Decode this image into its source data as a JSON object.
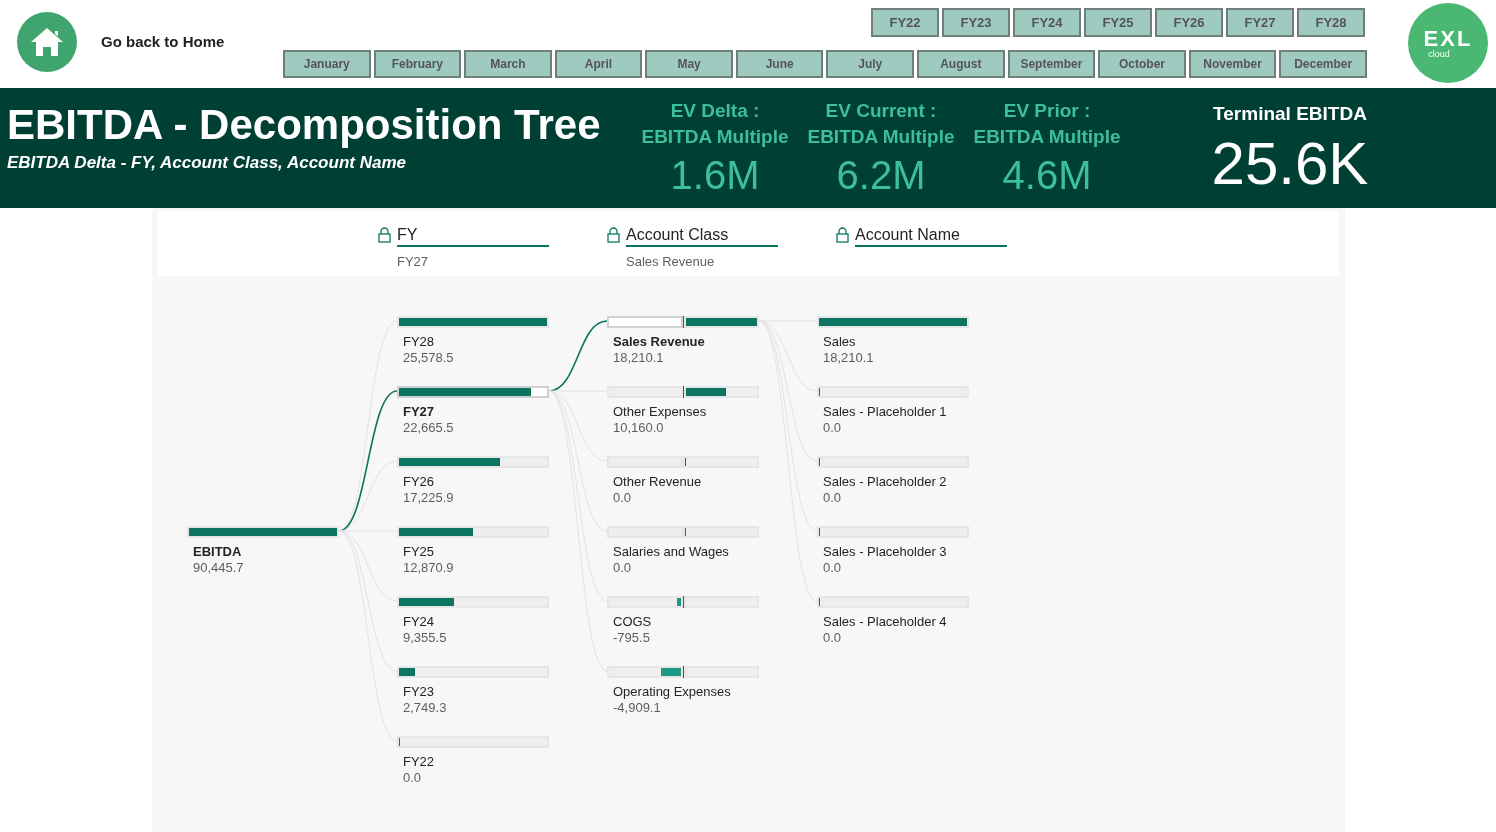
{
  "home_link": {
    "label": "Go back to Home"
  },
  "fy_buttons": [
    "FY22",
    "FY23",
    "FY24",
    "FY25",
    "FY26",
    "FY27",
    "FY28"
  ],
  "month_buttons": [
    "January",
    "February",
    "March",
    "April",
    "May",
    "June",
    "July",
    "August",
    "September",
    "October",
    "November",
    "December"
  ],
  "logo": {
    "text": "EXL",
    "subtext": "cloud"
  },
  "banner": {
    "title": "EBITDA - Decomposition Tree",
    "subtitle": "EBITDA Delta - FY, Account Class, Account Name",
    "kpis": [
      {
        "label_1": "EV Delta :",
        "label_2": "EBITDA Multiple",
        "value": "1.6M"
      },
      {
        "label_1": "EV Current :",
        "label_2": "EBITDA Multiple",
        "value": "6.2M"
      },
      {
        "label_1": "EV Prior :",
        "label_2": "EBITDA Multiple",
        "value": "4.6M"
      }
    ],
    "terminal": {
      "label": "Terminal EBITDA",
      "value": "25.6K"
    }
  },
  "tree": {
    "headers": [
      {
        "label": "FY",
        "selection": "FY27"
      },
      {
        "label": "Account Class",
        "selection": "Sales Revenue"
      },
      {
        "label": "Account Name"
      }
    ],
    "root": {
      "label": "EBITDA",
      "value": "90,445.7",
      "level": 1,
      "selected": true
    },
    "columns": [
      {
        "kind": "bar",
        "nodes": [
          {
            "label": "FY28",
            "value": "25,578.5",
            "level": 1,
            "selected": false
          },
          {
            "label": "FY27",
            "value": "22,665.5",
            "level": 0.89,
            "selected": true
          },
          {
            "label": "FY26",
            "value": "17,225.9",
            "level": 0.68,
            "selected": false
          },
          {
            "label": "FY25",
            "value": "12,870.9",
            "level": 0.5,
            "selected": false
          },
          {
            "label": "FY24",
            "value": "9,355.5",
            "level": 0.37,
            "selected": false
          },
          {
            "label": "FY23",
            "value": "2,749.3",
            "level": 0.11,
            "selected": false
          },
          {
            "label": "FY22",
            "value": "0.0",
            "level": 0,
            "selected": false
          }
        ]
      },
      {
        "kind": "diverging",
        "nodes": [
          {
            "label": "Sales Revenue",
            "value": "18,210.1",
            "level": 1,
            "negative": false,
            "selected": true
          },
          {
            "label": "Other Expenses",
            "value": "10,160.0",
            "level": 0.56,
            "negative": false,
            "selected": false
          },
          {
            "label": "Other Revenue",
            "value": "0.0",
            "level": 0,
            "selected": false
          },
          {
            "label": "Salaries and Wages",
            "value": "0.0",
            "level": 0,
            "selected": false
          },
          {
            "label": "COGS",
            "value": "-795.5",
            "level": 0.06,
            "negative": true,
            "selected": false
          },
          {
            "label": "Operating Expenses",
            "value": "-4,909.1",
            "level": 0.28,
            "negative": true,
            "selected": false
          }
        ]
      },
      {
        "kind": "bar",
        "nodes": [
          {
            "label": "Sales",
            "value": "18,210.1",
            "level": 1,
            "selected": false
          },
          {
            "label": "Sales - Placeholder 1",
            "value": "0.0",
            "level": 0,
            "selected": false
          },
          {
            "label": "Sales - Placeholder 2",
            "value": "0.0",
            "level": 0,
            "selected": false
          },
          {
            "label": "Sales - Placeholder 3",
            "value": "0.0",
            "level": 0,
            "selected": false
          },
          {
            "label": "Sales - Placeholder 4",
            "value": "0.0",
            "level": 0,
            "selected": false
          }
        ]
      }
    ]
  }
}
